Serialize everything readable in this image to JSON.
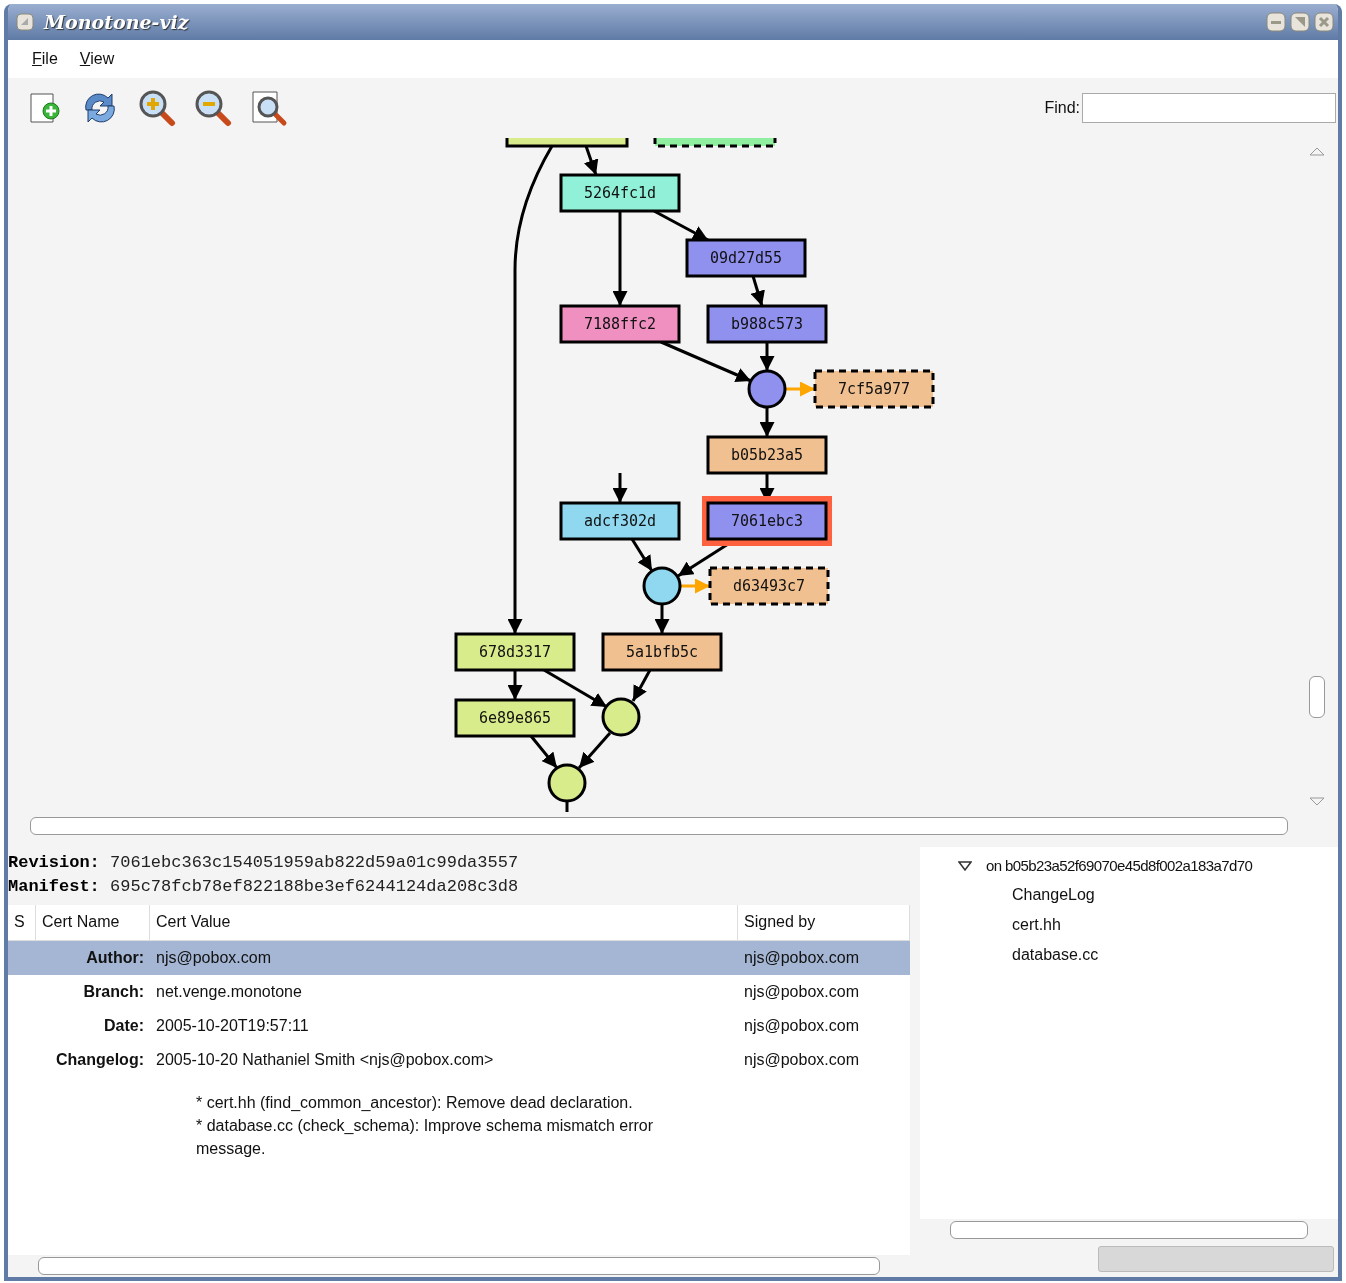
{
  "window": {
    "title": "Monotone-viz"
  },
  "menu": [
    {
      "label": "File"
    },
    {
      "label": "View"
    }
  ],
  "toolbar": [
    {
      "kind": "new"
    },
    {
      "kind": "reload"
    },
    {
      "kind": "zoom-in"
    },
    {
      "kind": "zoom-out"
    },
    {
      "kind": "zoom-fit"
    }
  ],
  "find": {
    "label": "Find:"
  },
  "graph": {
    "nodes": [
      {
        "kind": "revision",
        "color": "#d8ec8c",
        "selected": false
      },
      {
        "kind": "dashed",
        "color": "#90eea0"
      },
      {
        "kind": "revision",
        "label": "5264fc1d",
        "color": "#90f0d8",
        "selected": false
      },
      {
        "kind": "revision",
        "label": "09d27d55",
        "color": "#9090ee",
        "selected": false
      },
      {
        "kind": "revision",
        "label": "7188ffc2",
        "color": "#f090c0",
        "selected": false
      },
      {
        "kind": "revision",
        "label": "b988c573",
        "color": "#9090ee",
        "selected": false
      },
      {
        "kind": "merge",
        "color": "#9090ee"
      },
      {
        "kind": "dashed",
        "label": "7cf5a977",
        "color": "#f0c090"
      },
      {
        "kind": "revision",
        "label": "b05b23a5",
        "color": "#f0c090",
        "selected": false
      },
      {
        "kind": "revision",
        "label": "adcf302d",
        "color": "#90d8f0",
        "selected": false
      },
      {
        "kind": "revision",
        "label": "7061ebc3",
        "color": "#9090ee",
        "selected": true
      },
      {
        "kind": "merge",
        "color": "#90d8f0"
      },
      {
        "kind": "dashed",
        "label": "d63493c7",
        "color": "#f0c090"
      },
      {
        "kind": "revision",
        "label": "678d3317",
        "color": "#d8ec8c",
        "selected": false
      },
      {
        "kind": "revision",
        "label": "5a1bfb5c",
        "color": "#f0c090",
        "selected": false
      },
      {
        "kind": "revision",
        "label": "6e89e865",
        "color": "#d8ec8c",
        "selected": false
      },
      {
        "kind": "merge",
        "color": "#d8ec8c"
      },
      {
        "kind": "merge",
        "color": "#d8ec8c"
      }
    ]
  },
  "details": {
    "revision_label": "Revision:",
    "revision": "7061ebc363c154051959ab822d59a01c99da3557",
    "manifest_label": "Manifest:",
    "manifest": "695c78fcb78ef822188be3ef6244124da208c3d8"
  },
  "certs": {
    "columns": [
      "S",
      "Cert Name",
      "Cert Value",
      "Signed by"
    ],
    "rows": [
      {
        "name": "Author:",
        "value": "njs@pobox.com",
        "signed_by": "njs@pobox.com",
        "selected": true
      },
      {
        "name": "Branch:",
        "value": "net.venge.monotone",
        "signed_by": "njs@pobox.com",
        "selected": false
      },
      {
        "name": "Date:",
        "value": "2005-10-20T19:57:11",
        "signed_by": "njs@pobox.com",
        "selected": false
      },
      {
        "name": "Changelog:",
        "value": "2005-10-20  Nathaniel Smith  <njs@pobox.com>",
        "body": [
          "* cert.hh (find_common_ancestor): Remove dead declaration.",
          "* database.cc (check_schema): Improve schema mismatch error message."
        ],
        "signed_by": "njs@pobox.com",
        "selected": false
      }
    ]
  },
  "files": {
    "label": "on b05b23a52f69070e45d8f002a183a7d70",
    "expanded": true,
    "children": [
      {
        "label": "ChangeLog"
      },
      {
        "label": "cert.hh"
      },
      {
        "label": "database.cc"
      }
    ]
  }
}
